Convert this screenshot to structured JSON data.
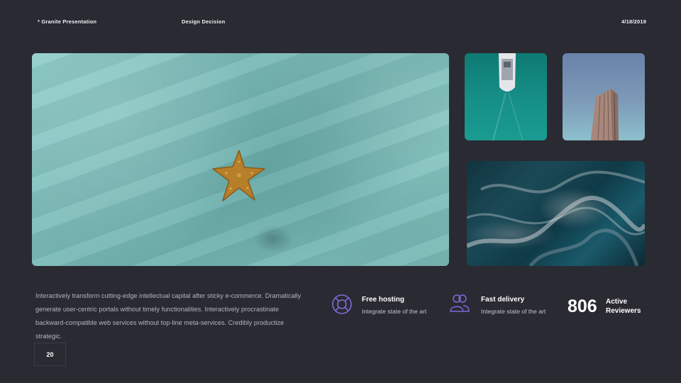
{
  "header": {
    "left": "* Granite Presentation",
    "center": "Design Decision",
    "date": "4/18/2019"
  },
  "images": {
    "main": "starfish-on-sand-image",
    "top_left": "boat-aerial-image",
    "top_right": "tower-image",
    "bottom": "marble-texture-image"
  },
  "body_text": "Interactively transform cutting-edge intellectual capital after sticky e-commerce. Dramatically generate user-centric portals without timely functionalities. Interactively procrastinate backward-compatible web services without top-line meta-services. Credibly productize strategic.",
  "features": [
    {
      "icon": "lifebuoy-icon",
      "title": "Free hosting",
      "subtitle": "Integrate state of the art"
    },
    {
      "icon": "users-icon",
      "title": "Fast delivery",
      "subtitle": "Integrate state of the art"
    }
  ],
  "stat": {
    "value": "806",
    "label_line1": "Active",
    "label_line2": "Reviewers"
  },
  "page_number": "20",
  "colors": {
    "background": "#2a2a33",
    "icon_accent": "#7e6bd8",
    "text_muted": "#b4b4be"
  }
}
